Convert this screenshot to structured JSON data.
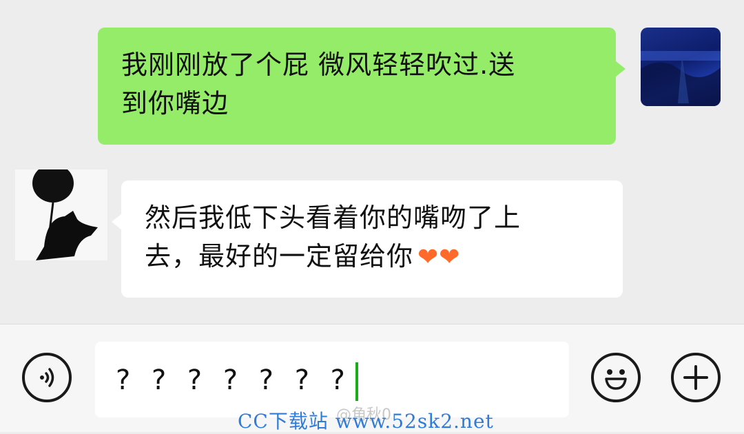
{
  "chat": {
    "messages": [
      {
        "sender": "self",
        "text_line1": "我刚刚放了个屁 微风轻轻吹过.送",
        "text_line2": "到你嘴边"
      },
      {
        "sender": "other",
        "text_line1": "然后我低下头看着你的嘴吻了上",
        "text_line2": "去，最好的一定留给你",
        "hearts": "❤❤"
      }
    ]
  },
  "input": {
    "value": "? ? ? ? ? ? ?"
  },
  "icons": {
    "voice": "voice-icon",
    "emoji": "emoji-icon",
    "plus": "plus-icon"
  },
  "watermark": {
    "text": "CC下载站 www.52sk2.net",
    "weibo": "@角秋0"
  },
  "colors": {
    "self_bubble": "#95ec69",
    "other_bubble": "#ffffff",
    "background": "#ededed",
    "caret": "#1aad19",
    "watermark": "#2f7bd8"
  }
}
